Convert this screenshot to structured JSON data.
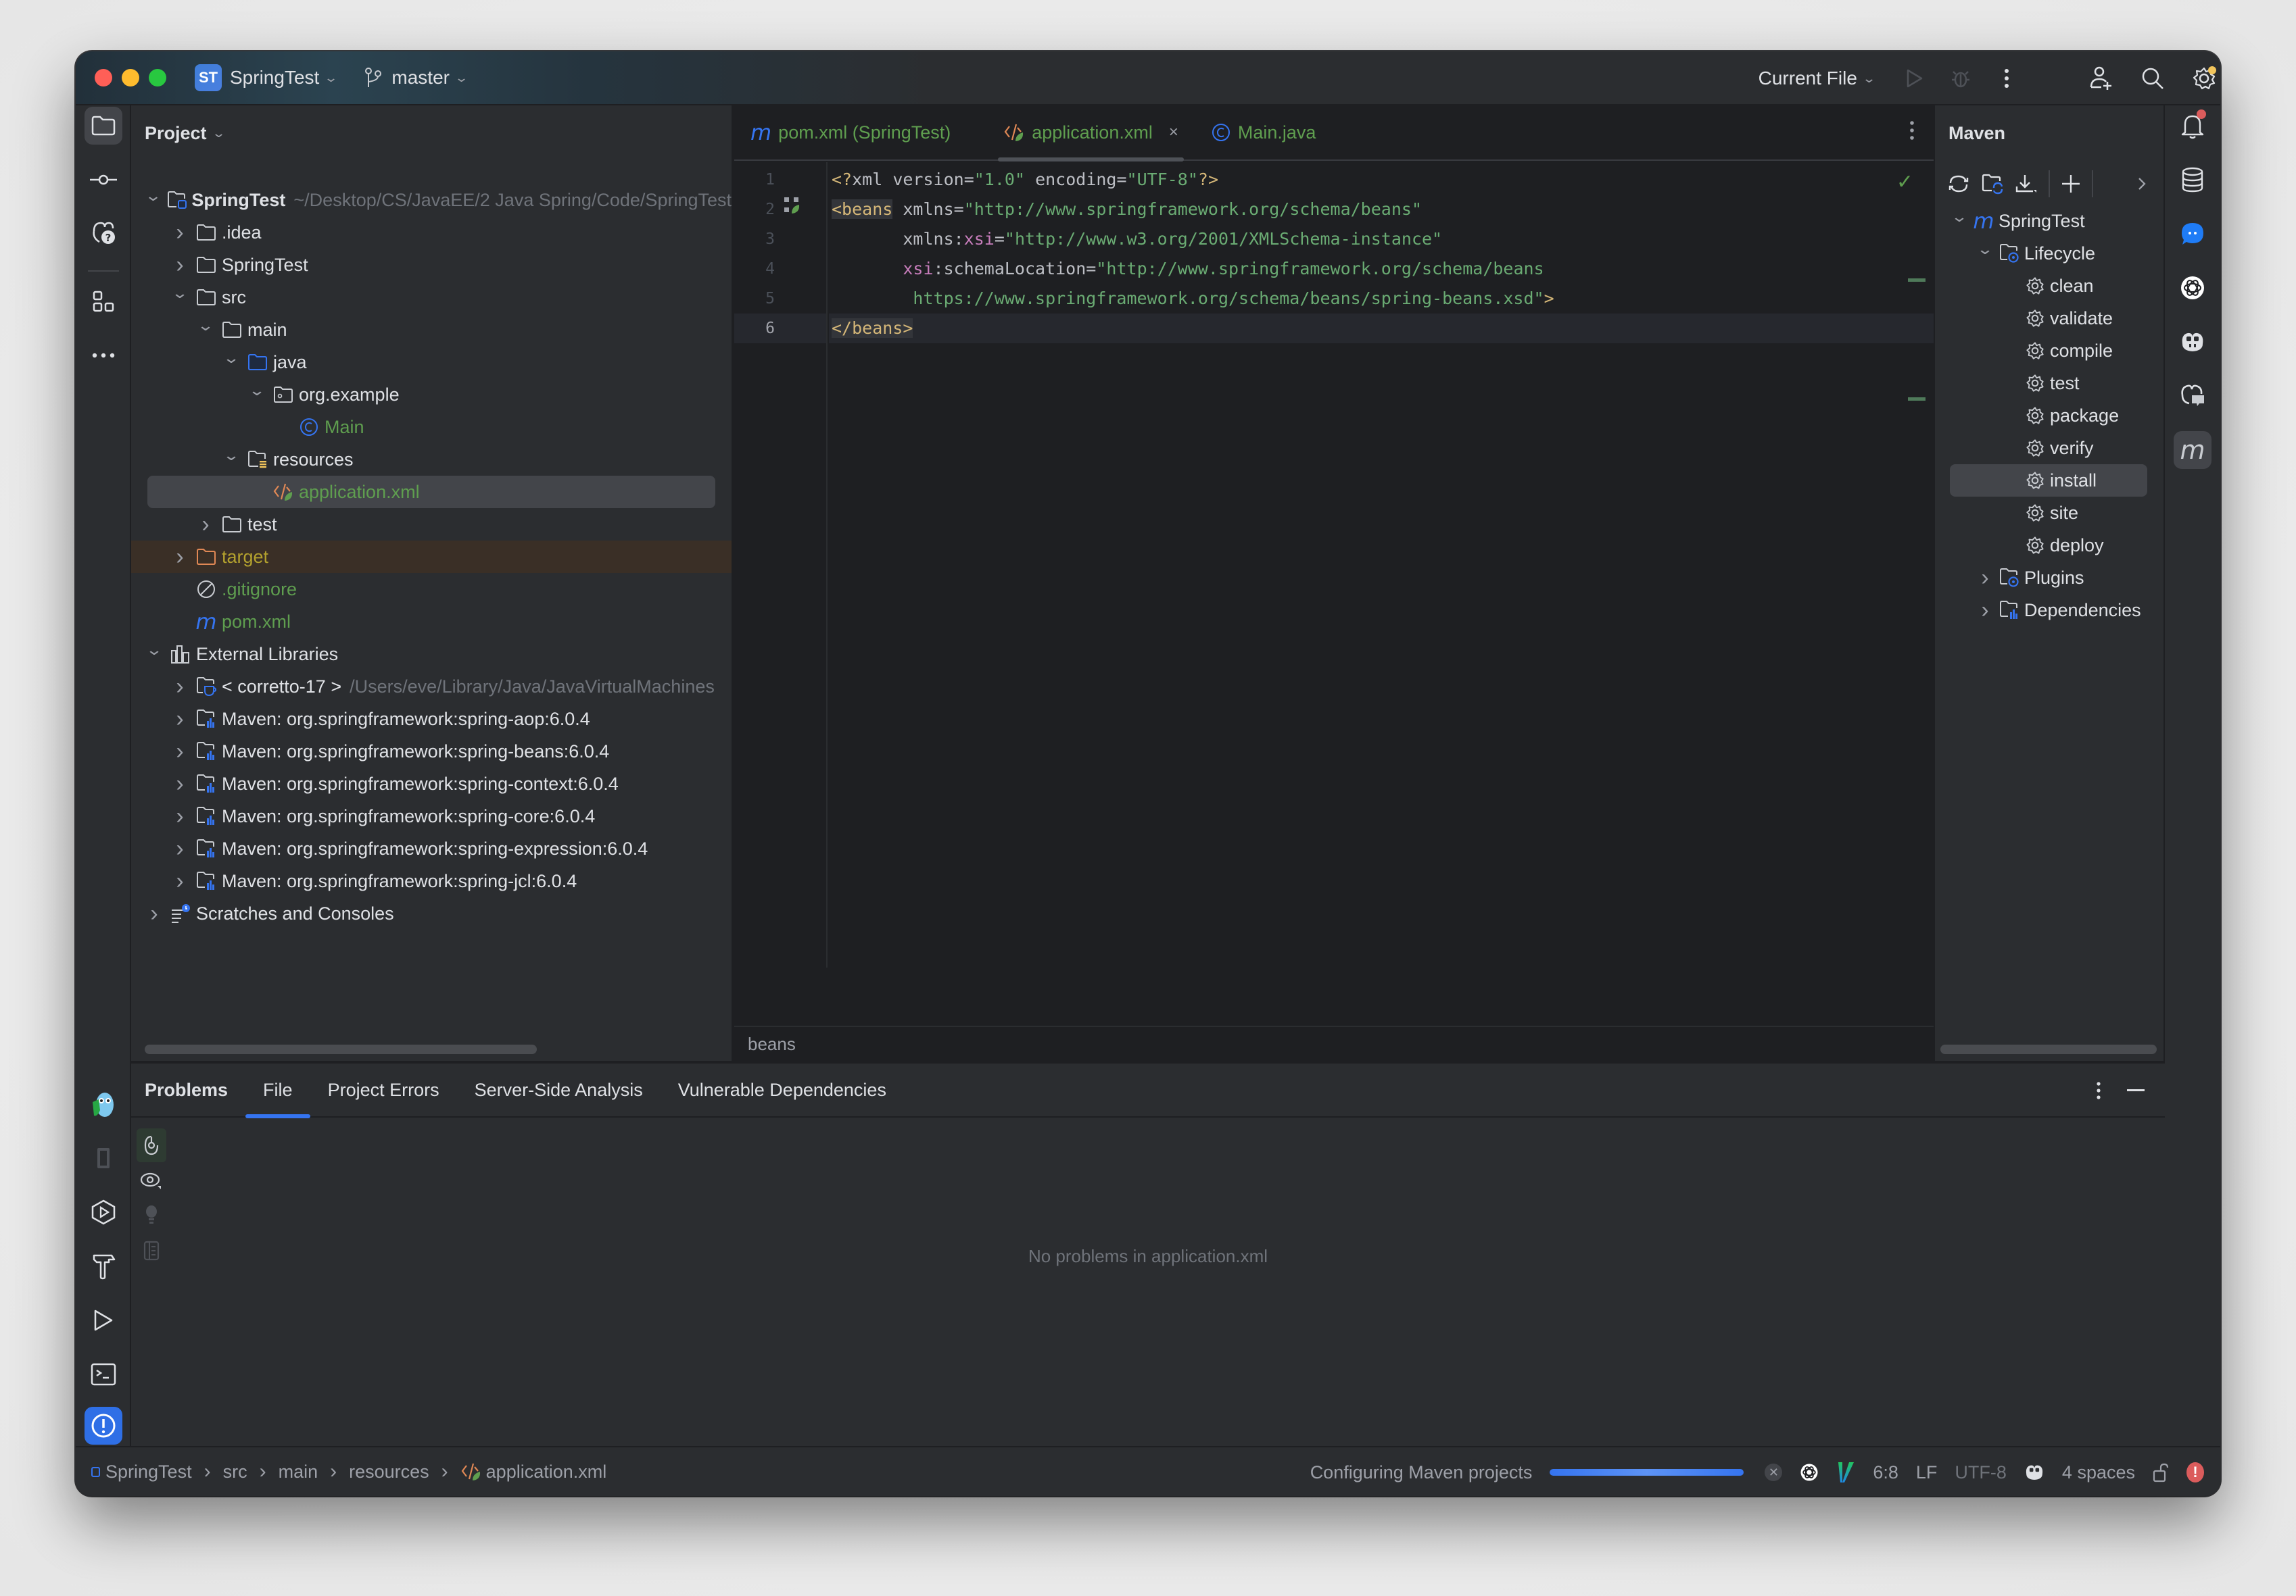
{
  "titlebar": {
    "project_badge": "ST",
    "project_name": "SpringTest",
    "branch": "master",
    "run_config": "Current File"
  },
  "project_panel": {
    "title": "Project",
    "tree": [
      {
        "label": "SpringTest",
        "sub": "~/Desktop/CS/JavaEE/2 Java Spring/Code/SpringTest",
        "icon": "module-folder-icon",
        "expanded": true,
        "depth": 0
      },
      {
        "label": ".idea",
        "icon": "folder-icon",
        "expanded": false,
        "depth": 1
      },
      {
        "label": "SpringTest",
        "icon": "folder-icon",
        "expanded": false,
        "depth": 1
      },
      {
        "label": "src",
        "icon": "folder-icon",
        "expanded": true,
        "depth": 1
      },
      {
        "label": "main",
        "icon": "folder-icon",
        "expanded": true,
        "depth": 2
      },
      {
        "label": "java",
        "icon": "source-folder-icon",
        "expanded": true,
        "depth": 3
      },
      {
        "label": "org.example",
        "icon": "package-icon",
        "expanded": true,
        "depth": 4
      },
      {
        "label": "Main",
        "icon": "java-class-icon",
        "depth": 5
      },
      {
        "label": "resources",
        "icon": "resources-folder-icon",
        "expanded": true,
        "depth": 3
      },
      {
        "label": "application.xml",
        "icon": "spring-xml-icon",
        "depth": 4,
        "selected": true
      },
      {
        "label": "test",
        "icon": "folder-icon",
        "expanded": false,
        "depth": 2
      },
      {
        "label": "target",
        "icon": "excluded-folder-icon",
        "expanded": false,
        "depth": 1
      },
      {
        "label": ".gitignore",
        "icon": "ignore-file-icon",
        "depth": 1
      },
      {
        "label": "pom.xml",
        "icon": "maven-icon",
        "depth": 1
      },
      {
        "label": "External Libraries",
        "icon": "libraries-icon",
        "expanded": true,
        "depth": 0
      },
      {
        "label": "< corretto-17 >",
        "sub": "/Users/eve/Library/Java/JavaVirtualMachines",
        "icon": "jdk-icon",
        "expanded": false,
        "depth": 1
      },
      {
        "label": "Maven: org.springframework:spring-aop:6.0.4",
        "icon": "library-icon",
        "expanded": false,
        "depth": 1
      },
      {
        "label": "Maven: org.springframework:spring-beans:6.0.4",
        "icon": "library-icon",
        "expanded": false,
        "depth": 1
      },
      {
        "label": "Maven: org.springframework:spring-context:6.0.4",
        "icon": "library-icon",
        "expanded": false,
        "depth": 1
      },
      {
        "label": "Maven: org.springframework:spring-core:6.0.4",
        "icon": "library-icon",
        "expanded": false,
        "depth": 1
      },
      {
        "label": "Maven: org.springframework:spring-expression:6.0.4",
        "icon": "library-icon",
        "expanded": false,
        "depth": 1
      },
      {
        "label": "Maven: org.springframework:spring-jcl:6.0.4",
        "icon": "library-icon",
        "expanded": false,
        "depth": 1
      },
      {
        "label": "Scratches and Consoles",
        "icon": "scratches-icon",
        "expanded": false,
        "depth": 0
      }
    ]
  },
  "editor": {
    "tabs": [
      {
        "label": "pom.xml (SpringTest)",
        "icon": "maven-icon",
        "active": false
      },
      {
        "label": "application.xml",
        "icon": "spring-xml-icon",
        "active": true,
        "close": "×"
      },
      {
        "label": "Main.java",
        "icon": "java-class-icon",
        "active": false
      }
    ],
    "line_numbers": [
      "1",
      "2",
      "3",
      "4",
      "5",
      "6"
    ],
    "current_line": 6,
    "lines": [
      [
        {
          "t": "<?",
          "c": "c-pi"
        },
        {
          "t": "xml ",
          "c": "c-attr"
        },
        {
          "t": "version",
          "c": "c-attr"
        },
        {
          "t": "=",
          "c": "c-attr"
        },
        {
          "t": "\"1.0\"",
          "c": "c-str"
        },
        {
          "t": " encoding",
          "c": "c-attr"
        },
        {
          "t": "=",
          "c": "c-attr"
        },
        {
          "t": "\"UTF-8\"",
          "c": "c-str"
        },
        {
          "t": "?>",
          "c": "c-pi"
        }
      ],
      [
        {
          "t": "<beans",
          "c": "c-tag tag-hl"
        },
        {
          "t": " xmlns",
          "c": "c-attr"
        },
        {
          "t": "=",
          "c": "c-attr"
        },
        {
          "t": "\"http://www.springframework.org/schema/beans\"",
          "c": "c-str"
        }
      ],
      [
        {
          "t": "       xmlns:",
          "c": "c-attr"
        },
        {
          "t": "xsi",
          "c": "c-ns"
        },
        {
          "t": "=",
          "c": "c-attr"
        },
        {
          "t": "\"http://www.w3.org/2001/XMLSchema-instance\"",
          "c": "c-str"
        }
      ],
      [
        {
          "t": "       ",
          "c": "c-attr"
        },
        {
          "t": "xsi",
          "c": "c-ns"
        },
        {
          "t": ":schemaLocation",
          "c": "c-attr"
        },
        {
          "t": "=",
          "c": "c-attr"
        },
        {
          "t": "\"http://www.springframework.org/schema/beans",
          "c": "c-str"
        }
      ],
      [
        {
          "t": "        https://www.springframework.org/schema/beans/spring-beans.xsd\"",
          "c": "c-str"
        },
        {
          "t": ">",
          "c": "c-tag"
        }
      ],
      [
        {
          "t": "</beans>",
          "c": "c-tag tag-hl"
        }
      ]
    ],
    "breadcrumb": "beans"
  },
  "maven": {
    "title": "Maven",
    "tree": [
      {
        "label": "SpringTest",
        "icon": "maven-icon",
        "expanded": true,
        "depth": 0
      },
      {
        "label": "Lifecycle",
        "icon": "lifecycle-folder-icon",
        "expanded": true,
        "depth": 1
      },
      {
        "label": "clean",
        "icon": "gear-icon",
        "depth": 2
      },
      {
        "label": "validate",
        "icon": "gear-icon",
        "depth": 2
      },
      {
        "label": "compile",
        "icon": "gear-icon",
        "depth": 2
      },
      {
        "label": "test",
        "icon": "gear-icon",
        "depth": 2
      },
      {
        "label": "package",
        "icon": "gear-icon",
        "depth": 2
      },
      {
        "label": "verify",
        "icon": "gear-icon",
        "depth": 2
      },
      {
        "label": "install",
        "icon": "gear-icon",
        "depth": 2,
        "selected": true
      },
      {
        "label": "site",
        "icon": "gear-icon",
        "depth": 2
      },
      {
        "label": "deploy",
        "icon": "gear-icon",
        "depth": 2
      },
      {
        "label": "Plugins",
        "icon": "plugins-folder-icon",
        "expanded": false,
        "depth": 1
      },
      {
        "label": "Dependencies",
        "icon": "dependencies-folder-icon",
        "expanded": false,
        "depth": 1
      }
    ]
  },
  "problems": {
    "title": "Problems",
    "tabs": [
      "File",
      "Project Errors",
      "Server-Side Analysis",
      "Vulnerable Dependencies"
    ],
    "active_tab": "File",
    "empty_message": "No problems in application.xml"
  },
  "statusbar": {
    "breadcrumb": [
      "SpringTest",
      "src",
      "main",
      "resources",
      "application.xml"
    ],
    "task": "Configuring Maven projects",
    "progress": 0.98,
    "position": "6:8",
    "line_separator": "LF",
    "encoding": "UTF-8",
    "indent": "4 spaces"
  },
  "colors": {
    "accent": "#3574f0",
    "file_green": "#5f9e4f",
    "error": "#db5c5c"
  }
}
